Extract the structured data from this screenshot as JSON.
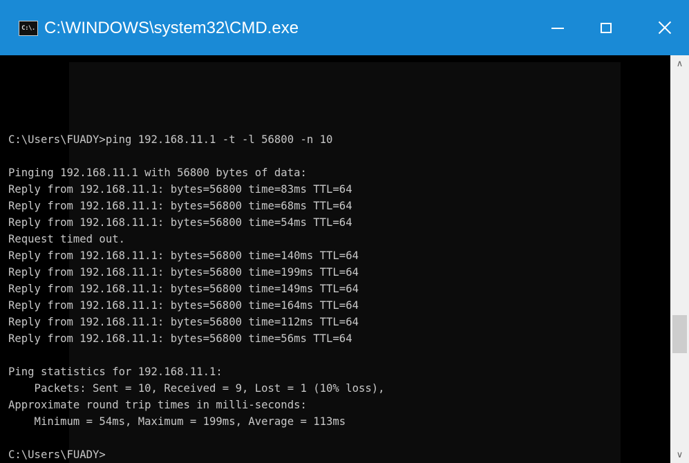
{
  "window": {
    "title": "C:\\WINDOWS\\system32\\CMD.exe",
    "icon_label": "C:\\.",
    "icon": "cmd-icon",
    "controls": [
      "minimize-icon",
      "maximize-icon",
      "close-icon"
    ]
  },
  "console": {
    "lines": [
      "C:\\Users\\FUADY>ping 192.168.11.1 -t -l 56800 -n 10",
      "",
      "Pinging 192.168.11.1 with 56800 bytes of data:",
      "Reply from 192.168.11.1: bytes=56800 time=83ms TTL=64",
      "Reply from 192.168.11.1: bytes=56800 time=68ms TTL=64",
      "Reply from 192.168.11.1: bytes=56800 time=54ms TTL=64",
      "Request timed out.",
      "Reply from 192.168.11.1: bytes=56800 time=140ms TTL=64",
      "Reply from 192.168.11.1: bytes=56800 time=199ms TTL=64",
      "Reply from 192.168.11.1: bytes=56800 time=149ms TTL=64",
      "Reply from 192.168.11.1: bytes=56800 time=164ms TTL=64",
      "Reply from 192.168.11.1: bytes=56800 time=112ms TTL=64",
      "Reply from 192.168.11.1: bytes=56800 time=56ms TTL=64",
      "",
      "Ping statistics for 192.168.11.1:",
      "    Packets: Sent = 10, Received = 9, Lost = 1 (10% loss),",
      "Approximate round trip times in milli-seconds:",
      "    Minimum = 54ms, Maximum = 199ms, Average = 113ms",
      "",
      "C:\\Users\\FUADY>"
    ]
  },
  "scrollbar": {
    "up_icon": "chevron-up-icon",
    "down_icon": "chevron-down-icon"
  },
  "colors": {
    "titlebar": "#1a8ad6",
    "console_bg": "#0c0c0c",
    "console_text": "#c8c8c8"
  }
}
